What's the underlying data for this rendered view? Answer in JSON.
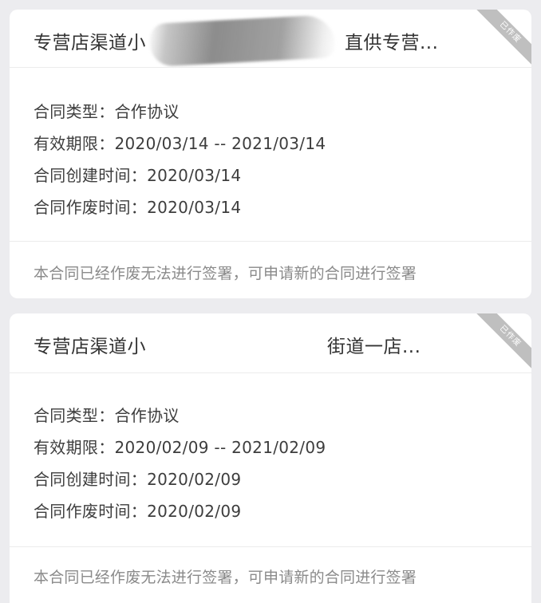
{
  "contracts": [
    {
      "title_start": "专营店渠道小",
      "title_end": "直供专营...",
      "status_ribbon": "已作废",
      "type_row": "合同类型：合作协议",
      "validity_row": "有效期限：2020/03/14 -- 2021/03/14",
      "created_row": "合同创建时间：2020/03/14",
      "voided_row": "合同作废时间：2020/03/14",
      "note": "本合同已经作废无法进行签署，可申请新的合同进行签署"
    },
    {
      "title_start": "专营店渠道小",
      "title_end": "街道一店...",
      "status_ribbon": "已作废",
      "type_row": "合同类型：合作协议",
      "validity_row": "有效期限：2020/02/09 -- 2021/02/09",
      "created_row": "合同创建时间：2020/02/09",
      "voided_row": "合同作废时间：2020/02/09",
      "note": "本合同已经作废无法进行签署，可申请新的合同进行签署"
    }
  ],
  "colors": {
    "page_background": "#ececef",
    "card_background": "#ffffff",
    "title_text": "#333333",
    "body_text": "#3d3d3d",
    "note_text": "#8a8a8a",
    "ribbon": "#bfbfbf"
  }
}
